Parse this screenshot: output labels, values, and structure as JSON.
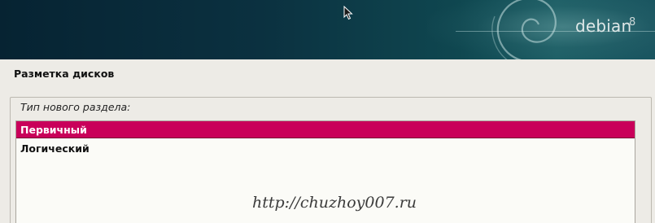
{
  "header": {
    "brand": "debian",
    "version": "8"
  },
  "page": {
    "title": "Разметка дисков"
  },
  "partition_type": {
    "label": "Тип нового раздела:",
    "options": [
      {
        "label": "Первичный",
        "selected": true
      },
      {
        "label": "Логический",
        "selected": false
      }
    ]
  },
  "watermark": "http://chuzhoy007.ru",
  "colors": {
    "selection": "#c9005a",
    "banner_dark": "#062332",
    "banner_light": "#1e5f66"
  }
}
